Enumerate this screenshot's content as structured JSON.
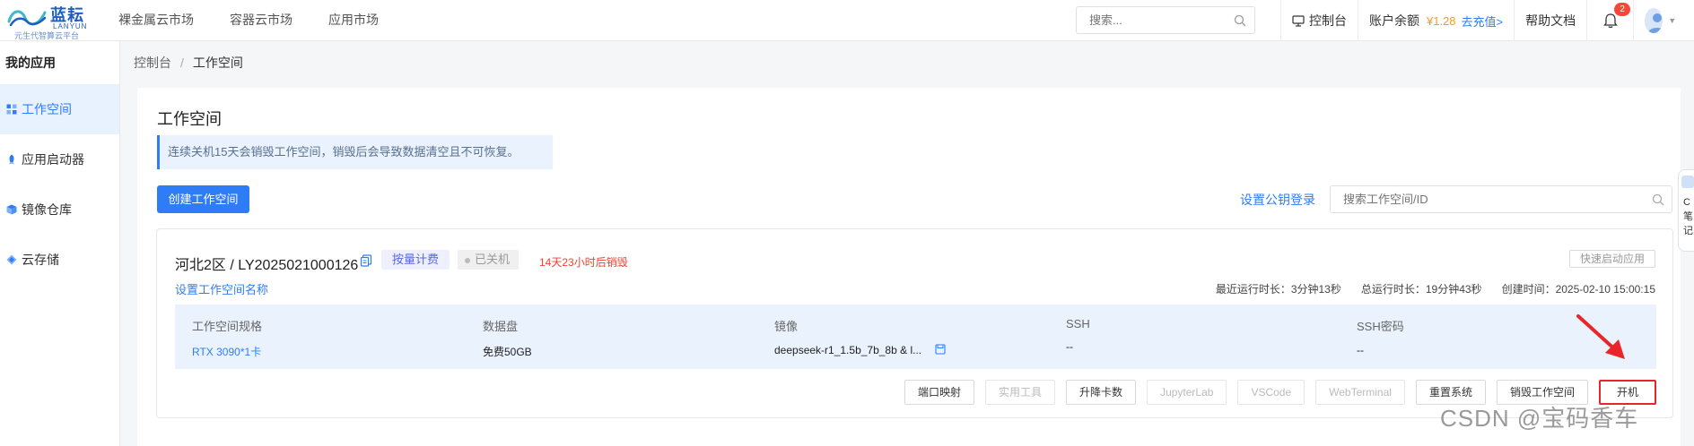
{
  "logo": {
    "brand_cn": "蓝耘",
    "brand_en": "LANYUN",
    "slogan": "元生代智算云平台",
    "colors": {
      "primary": "#1d5fbf",
      "accent": "#3fb8c7"
    }
  },
  "topnav": {
    "items": [
      "裸金属云市场",
      "容器云市场",
      "应用市场"
    ]
  },
  "top_search": {
    "placeholder": "搜索..."
  },
  "top_right": {
    "console": "控制台",
    "balance_label": "账户余额",
    "balance_value": "¥1.28",
    "recharge": "去充值>",
    "help": "帮助文档",
    "notification_count": "2"
  },
  "sidebar": {
    "title": "我的应用",
    "items": [
      {
        "label": "工作空间",
        "icon": "workspace-icon",
        "active": true
      },
      {
        "label": "应用启动器",
        "icon": "rocket-icon",
        "active": false
      },
      {
        "label": "镜像仓库",
        "icon": "image-repo-icon",
        "active": false
      },
      {
        "label": "云存储",
        "icon": "cloud-storage-icon",
        "active": false
      }
    ]
  },
  "breadcrumb": {
    "root": "控制台",
    "current": "工作空间"
  },
  "main": {
    "title": "工作空间",
    "notice": "连续关机15天会销毁工作空间，销毁后会导致数据清空且不可恢复。",
    "create_button": "创建工作空间",
    "ssh_key_link": "设置公钥登录",
    "search_placeholder": "搜索工作空间/ID"
  },
  "workspace": {
    "name": "河北2区 / LY2025021000126",
    "billing_tag": "按量计费",
    "status": "已关机",
    "destroy_warning": "14天23小时后销毁",
    "quick_launch": "快速启动应用",
    "rename_link": "设置工作空间名称",
    "recent_runtime": "最近运行时长：3分钟13秒",
    "total_runtime": "总运行时长：19分钟43秒",
    "created_at": "创建时间：2025-02-10 15:00:15",
    "specs": [
      {
        "key": "工作空间规格",
        "value": "RTX 3090*1卡"
      },
      {
        "key": "数据盘",
        "value": "免费50GB"
      },
      {
        "key": "镜像",
        "value": "deepseek-r1_1.5b_7b_8b & l..."
      },
      {
        "key": "SSH",
        "value": "--"
      },
      {
        "key": "SSH密码",
        "value": "--"
      }
    ],
    "actions": [
      {
        "label": "端口映射",
        "disabled": false
      },
      {
        "label": "实用工具",
        "disabled": true
      },
      {
        "label": "升降卡数",
        "disabled": false
      },
      {
        "label": "JupyterLab",
        "disabled": true
      },
      {
        "label": "VSCode",
        "disabled": true
      },
      {
        "label": "WebTerminal",
        "disabled": true
      },
      {
        "label": "重置系统",
        "disabled": false
      },
      {
        "label": "销毁工作空间",
        "disabled": false
      },
      {
        "label": "开机",
        "disabled": false
      }
    ]
  },
  "float_widget": {
    "text": "C\n笔\n记"
  },
  "watermark": "CSDN @宝码香车",
  "colors": {
    "primary": "#2f7df6",
    "warning": "#f0402f",
    "highlight": "#e8262a",
    "balance": "#f59a23"
  }
}
